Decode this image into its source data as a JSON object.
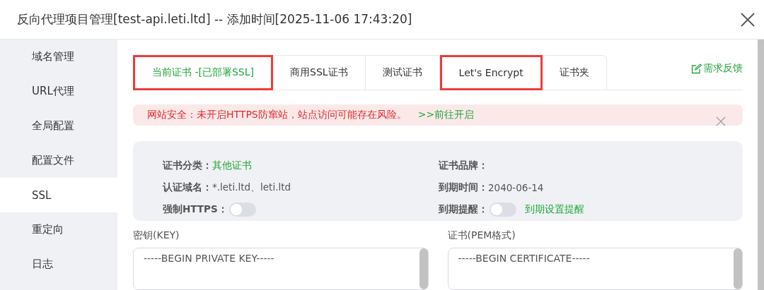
{
  "window": {
    "title": "反向代理项目管理[test-api.leti.ltd] -- 添加时间[2025-11-06 17:43:20]"
  },
  "sidebar": {
    "items": [
      {
        "label": "域名管理",
        "selected": false
      },
      {
        "label": "URL代理",
        "selected": false
      },
      {
        "label": "全局配置",
        "selected": false
      },
      {
        "label": "配置文件",
        "selected": false
      },
      {
        "label": "SSL",
        "selected": true
      },
      {
        "label": "重定向",
        "selected": false
      },
      {
        "label": "日志",
        "selected": false
      }
    ]
  },
  "tabs": [
    {
      "label": "当前证书 -[已部署SSL]",
      "selected": true,
      "highlighted": true
    },
    {
      "label": "商用SSL证书",
      "selected": false,
      "highlighted": false
    },
    {
      "label": "测试证书",
      "selected": false,
      "highlighted": false
    },
    {
      "label": "Let's Encrypt",
      "selected": false,
      "highlighted": true
    },
    {
      "label": "证书夹",
      "selected": false,
      "highlighted": false
    }
  ],
  "feedback_link": "需求反馈",
  "alert": {
    "message": "网站安全：未开启HTTPS防窜站，站点访问可能存在风险。",
    "link": ">>前往开启"
  },
  "cert_info": {
    "left": [
      {
        "label": "证书分类：",
        "kind": "status",
        "value": "其他证书"
      },
      {
        "label": "认证域名：",
        "kind": "text",
        "value": "*.leti.ltd、leti.ltd"
      },
      {
        "label": "强制HTTPS：",
        "kind": "toggle",
        "on": false
      }
    ],
    "right": [
      {
        "label": "证书品牌：",
        "kind": "text"
      },
      {
        "label": "到期时间：",
        "kind": "text",
        "value": "2040-06-14"
      },
      {
        "label": "到期提醒：",
        "kind": "toggle",
        "on": false,
        "link": "到期设置提醒"
      }
    ]
  },
  "key_field": {
    "label": "密钥(KEY)",
    "value": "-----BEGIN PRIVATE KEY-----"
  },
  "cert_field": {
    "label": "证书(PEM格式)",
    "value": "-----BEGIN CERTIFICATE-----"
  }
}
